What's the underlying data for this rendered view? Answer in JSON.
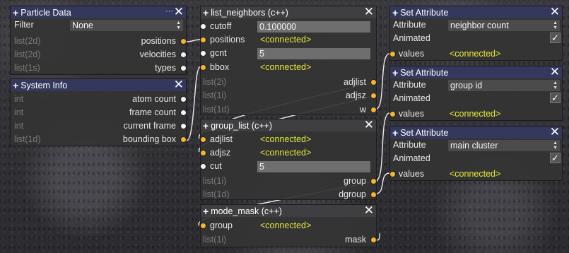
{
  "particle_data": {
    "title": "Particle Data",
    "filter_label": "Filter",
    "filter_value": "None",
    "outputs": [
      {
        "type": "list(2d)",
        "name": "positions"
      },
      {
        "type": "list(2d)",
        "name": "velocities"
      },
      {
        "type": "list(1s)",
        "name": "types"
      }
    ]
  },
  "system_info": {
    "title": "System Info",
    "outputs": [
      {
        "type": "int",
        "name": "atom count"
      },
      {
        "type": "int",
        "name": "frame count"
      },
      {
        "type": "int",
        "name": "current frame"
      },
      {
        "type": "list(1d)",
        "name": "bounding box"
      }
    ]
  },
  "list_neighbors": {
    "title": "list_neighbors (c++)",
    "inputs": [
      {
        "name": "cutoff",
        "value": "0.100000"
      },
      {
        "name": "positions",
        "value": "<connected>"
      },
      {
        "name": "gcnt",
        "value": "5"
      },
      {
        "name": "bbox",
        "value": "<connected>"
      }
    ],
    "outputs": [
      {
        "type": "list(2i)",
        "name": "adjlist"
      },
      {
        "type": "list(1i)",
        "name": "adjsz"
      },
      {
        "type": "list(1d)",
        "name": "w"
      }
    ]
  },
  "group_list": {
    "title": "group_list (c++)",
    "inputs": [
      {
        "name": "adjlist",
        "value": "<connected>"
      },
      {
        "name": "adjsz",
        "value": "<connected>"
      },
      {
        "name": "cut",
        "value": "5"
      }
    ],
    "outputs": [
      {
        "type": "list(1i)",
        "name": "group"
      },
      {
        "type": "list(1d)",
        "name": "dgroup"
      }
    ]
  },
  "mode_mask": {
    "title": "mode_mask (c++)",
    "inputs": [
      {
        "name": "group",
        "value": "<connected>"
      }
    ],
    "outputs": [
      {
        "type": "list(1i)",
        "name": "mask"
      }
    ]
  },
  "set_attributes": [
    {
      "title": "Set Attribute",
      "attribute_label": "Attribute",
      "attribute_value": "neighbor count",
      "animated_label": "Animated",
      "values_label": "values",
      "values_value": "<connected>"
    },
    {
      "title": "Set Attribute",
      "attribute_label": "Attribute",
      "attribute_value": "group id",
      "animated_label": "Animated",
      "values_label": "values",
      "values_value": "<connected>"
    },
    {
      "title": "Set Attribute",
      "attribute_label": "Attribute",
      "attribute_value": "main cluster",
      "animated_label": "Animated",
      "values_label": "values",
      "values_value": "<connected>"
    }
  ],
  "icons": {
    "add": "plus-icon",
    "close": "close-icon",
    "menu": "ellipsis-icon",
    "check": "checkmark-icon",
    "spin": "spinner-arrows-icon"
  },
  "colors": {
    "title_bar": "#34385c",
    "connected": "#e8e83a",
    "port_data": "#f4b631",
    "port_value": "#f2f2f2",
    "field_bg": "#6e6e6e"
  }
}
